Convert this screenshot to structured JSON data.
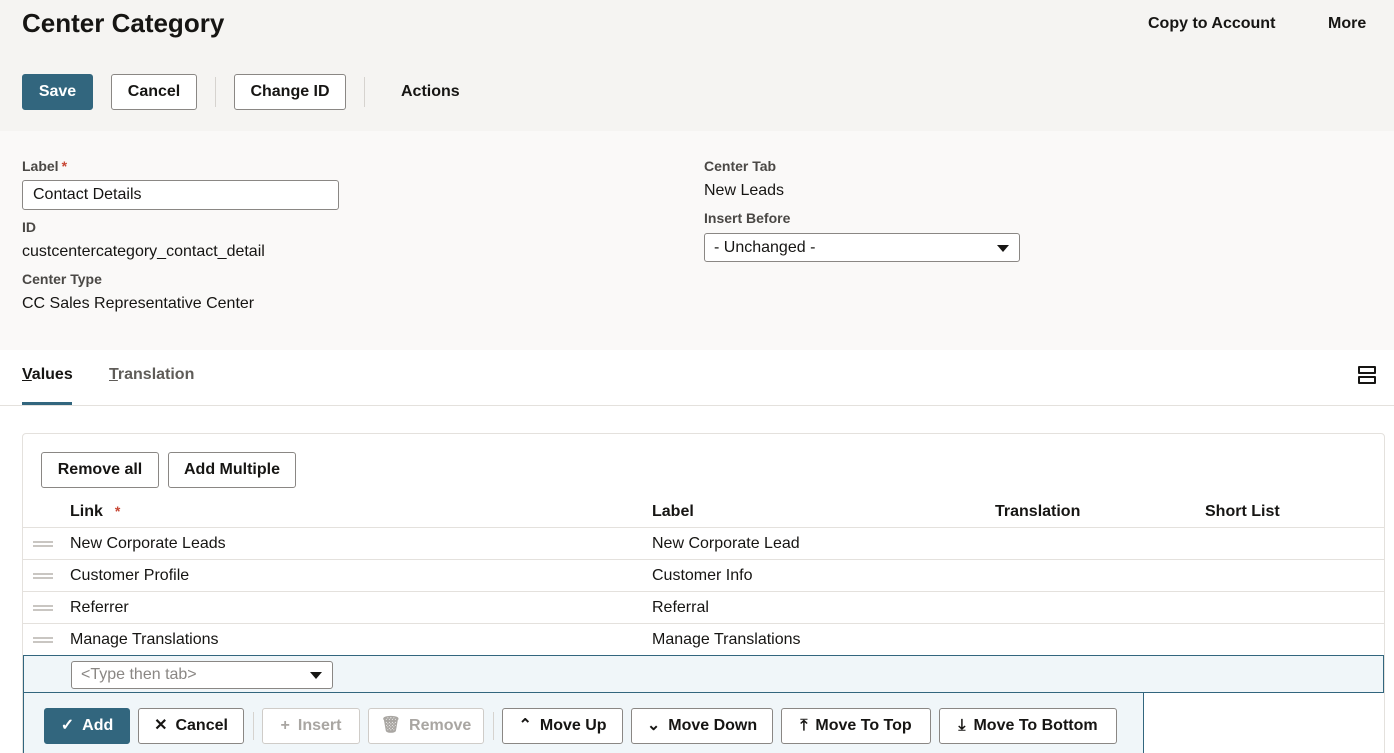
{
  "header": {
    "title": "Center Category",
    "copy_to_account": "Copy to Account",
    "more": "More"
  },
  "toolbar": {
    "save": "Save",
    "cancel": "Cancel",
    "change_id": "Change ID",
    "actions": "Actions"
  },
  "form": {
    "label_label": "Label",
    "required_mark": "*",
    "label_value": "Contact Details",
    "id_label": "ID",
    "id_value": "custcentercategory_contact_detail",
    "center_type_label": "Center Type",
    "center_type_value": "CC Sales Representative Center",
    "center_tab_label": "Center Tab",
    "center_tab_value": "New Leads",
    "insert_before_label": "Insert Before",
    "insert_before_value": "- Unchanged -"
  },
  "tabs": [
    {
      "first": "V",
      "rest": "alues"
    },
    {
      "first": "T",
      "rest": "ranslation"
    }
  ],
  "table": {
    "remove_all": "Remove all",
    "add_multiple": "Add Multiple",
    "columns": {
      "link": "Link",
      "link_required": "*",
      "label": "Label",
      "translation": "Translation",
      "short_list": "Short List"
    },
    "rows": [
      {
        "link": "New Corporate Leads",
        "label": "New Corporate Lead"
      },
      {
        "link": "Customer Profile",
        "label": "Customer Info"
      },
      {
        "link": "Referrer",
        "label": "Referral"
      },
      {
        "link": "Manage Translations",
        "label": "Manage Translations"
      }
    ],
    "new_row_placeholder": "<Type then tab>"
  },
  "row_actions": {
    "add": "Add",
    "cancel": "Cancel",
    "insert": "Insert",
    "remove": "Remove",
    "move_up": "Move Up",
    "move_down": "Move Down",
    "move_to_top": "Move To Top",
    "move_to_bottom": "Move To Bottom"
  },
  "colors": {
    "primary": "#32667e",
    "required": "#c74634"
  }
}
